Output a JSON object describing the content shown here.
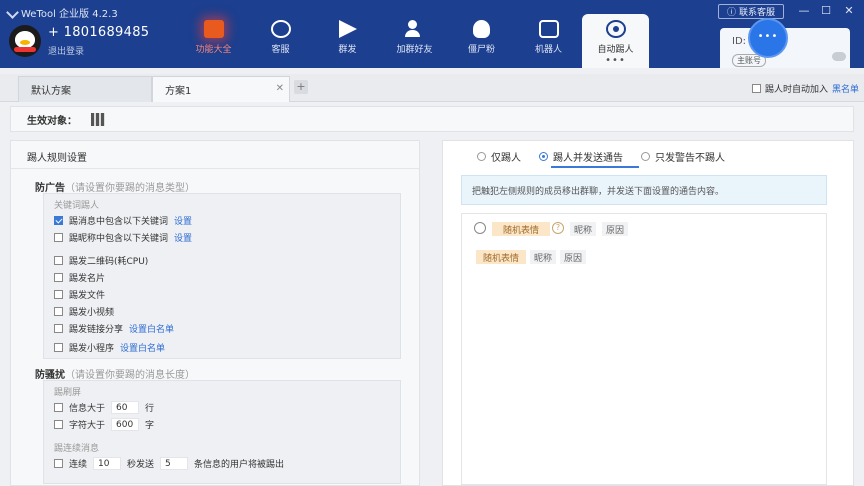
{
  "app": {
    "title": "WeTool 企业版 4.2.3"
  },
  "account": {
    "id": "+ 1801689485",
    "logout": "退出登录"
  },
  "nav": {
    "items": [
      {
        "label": "功能大全",
        "icon": "feature-icon"
      },
      {
        "label": "客服",
        "icon": "chat-icon"
      },
      {
        "label": "群发",
        "icon": "send-icon"
      },
      {
        "label": "加群好友",
        "icon": "add-friend-icon"
      },
      {
        "label": "僵尸粉",
        "icon": "skull-icon"
      },
      {
        "label": "机器人",
        "icon": "robot-icon"
      },
      {
        "label": "自动踢人",
        "icon": "kick-icon"
      }
    ],
    "active": "自动踢人",
    "more": "•••"
  },
  "header": {
    "help": "联系客服",
    "id_label": "ID:",
    "main_badge": "主账号",
    "window": {
      "minimize": "—",
      "maximize": "☐",
      "close": "✕"
    }
  },
  "tabs": {
    "items": [
      {
        "label": "默认方案"
      },
      {
        "label": "方案1"
      }
    ],
    "close": "✕",
    "add": "+",
    "auto_add_label": "踢人时自动加入",
    "blacklist": "黑名单"
  },
  "target": {
    "label": "生效对象："
  },
  "left": {
    "title": "踢人规则设置",
    "anti_ad": {
      "title": "防广告",
      "hint": "（请设置你要踢的消息类型）",
      "keyword_label": "关键词踢人",
      "keyword_rows": [
        {
          "label": "踢消息中包含以下关键词",
          "checked": true,
          "link": "设置"
        },
        {
          "label": "踢昵称中包含以下关键词",
          "checked": false,
          "link": "设置"
        }
      ],
      "rows": [
        {
          "label": "踢发二维码(耗CPU)",
          "checked": false,
          "link": ""
        },
        {
          "label": "踢发名片",
          "checked": false,
          "link": ""
        },
        {
          "label": "踢发文件",
          "checked": false,
          "link": ""
        },
        {
          "label": "踢发小视频",
          "checked": false,
          "link": ""
        },
        {
          "label": "踢发链接分享",
          "checked": false,
          "link": "设置白名单"
        },
        {
          "label": "踢发小程序",
          "checked": false,
          "link": "设置白名单"
        }
      ]
    },
    "anti_spam": {
      "title": "防骚扰",
      "hint": "（请设置你要踢的消息长度）",
      "spam_label": "踢刷屏",
      "rows": [
        {
          "label": "信息大于",
          "value": "60",
          "unit": "行",
          "checked": false
        },
        {
          "label": "字符大于",
          "value": "600",
          "unit": "字",
          "checked": false
        }
      ],
      "consecutive_label": "踢连续消息",
      "consecutive": {
        "checked": false,
        "label": "连续",
        "seconds": "10",
        "mid": "秒发送",
        "count": "5",
        "tail": "条信息的用户将被踢出"
      }
    }
  },
  "right": {
    "options": [
      {
        "label": "仅踢人",
        "selected": false
      },
      {
        "label": "踢人并发送通告",
        "selected": true
      },
      {
        "label": "只发警告不踢人",
        "selected": false
      }
    ],
    "info": "把触犯左侧规则的成员移出群聊，并发送下面设置的通告内容。",
    "toolbar": {
      "emoji_tag": "随机表情",
      "help": "?",
      "nickname": "昵称",
      "reason": "原因"
    },
    "content": {
      "emoji_tag": "随机表情",
      "nickname": "昵称",
      "reason": "原因"
    }
  },
  "colors": {
    "topbar": "#1c3f8f",
    "accent": "#3a79d8",
    "link": "#2d6cd4",
    "tag": "#fbe6c8"
  }
}
